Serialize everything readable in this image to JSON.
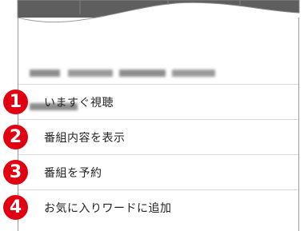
{
  "header": {
    "description": "(blurred program description text)"
  },
  "menu": {
    "items": [
      {
        "number": "1",
        "label": "いますぐ視聴"
      },
      {
        "number": "2",
        "label": "番組内容を表示"
      },
      {
        "number": "3",
        "label": "番組を予約"
      },
      {
        "number": "4",
        "label": "お気に入りワードに追加"
      }
    ]
  },
  "colors": {
    "badge": "#e00012",
    "tv_screen": "#606060",
    "divider": "#d8d8d8"
  }
}
